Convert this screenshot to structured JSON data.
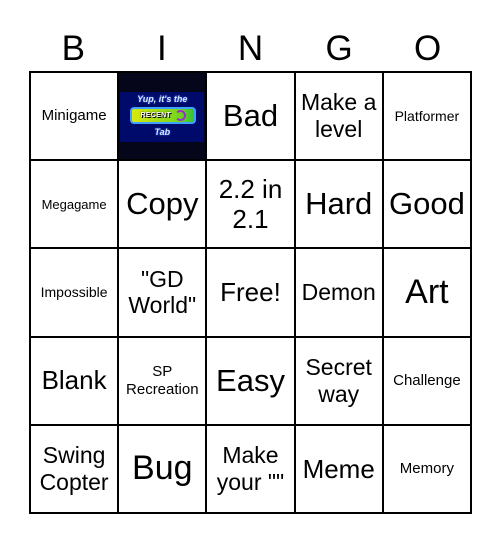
{
  "header": [
    "B",
    "I",
    "N",
    "G",
    "O"
  ],
  "image_cell": {
    "icon": "recent-tab-image",
    "line1": "Yup, it's the",
    "button": "RECENT",
    "line2": "Tab"
  },
  "cells": [
    [
      "Minigame",
      null,
      "Bad",
      "Make a level",
      "Platformer"
    ],
    [
      "Megagame",
      "Copy",
      "2.2 in 2.1",
      "Hard",
      "Good"
    ],
    [
      "Impossible",
      "\"GD World\"",
      "Free!",
      "Demon",
      "Art"
    ],
    [
      "Blank",
      "SP Recreation",
      "Easy",
      "Secret way",
      "Challenge"
    ],
    [
      "Swing Copter",
      "Bug",
      "Make your \"\"",
      "Meme",
      "Memory"
    ]
  ]
}
